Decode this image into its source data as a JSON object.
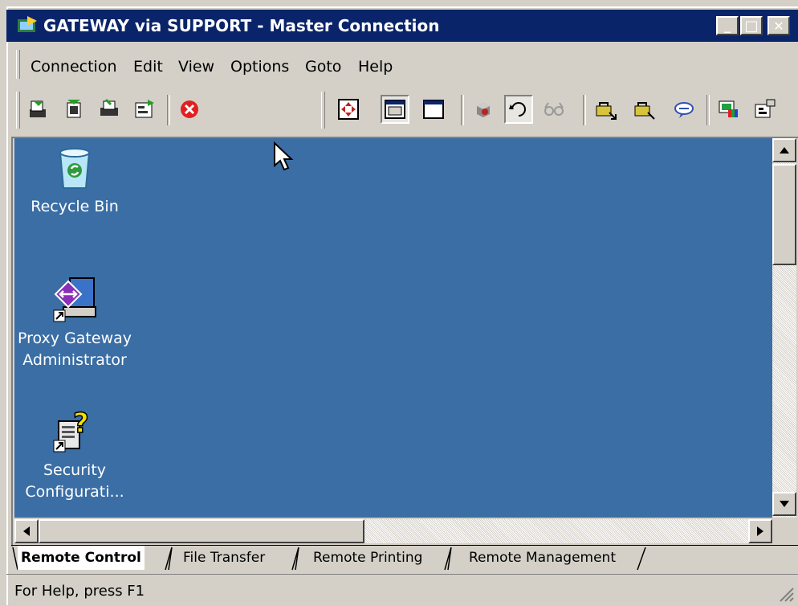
{
  "window": {
    "title": "GATEWAY via SUPPORT - Master Connection"
  },
  "title_buttons": {
    "minimize": "_",
    "maximize": "□",
    "close": "✕"
  },
  "menu": [
    {
      "label": "Connection"
    },
    {
      "label": "Edit"
    },
    {
      "label": "View"
    },
    {
      "label": "Options"
    },
    {
      "label": "Goto"
    },
    {
      "label": "Help"
    }
  ],
  "toolbar": {
    "icons": [
      "connect-icon",
      "disconnect-icon",
      "print-icon",
      "properties-icon",
      "stop-icon",
      "full-screen-icon",
      "window-icon",
      "window-frame-icon",
      "record-icon",
      "rotate-icon",
      "view-only-icon",
      "lock-keyboard-icon",
      "lock-mouse-icon",
      "chat-icon",
      "color-display-icon",
      "settings-icon"
    ]
  },
  "desktop": {
    "icons": [
      {
        "label_line1": "Recycle Bin",
        "label_line2": ""
      },
      {
        "label_line1": "Proxy Gateway",
        "label_line2": "Administrator"
      },
      {
        "label_line1": "Security",
        "label_line2": "Configurati..."
      }
    ]
  },
  "tabs": [
    {
      "label": "Remote Control",
      "active": true
    },
    {
      "label": "File Transfer",
      "active": false
    },
    {
      "label": "Remote Printing",
      "active": false
    },
    {
      "label": "Remote Management",
      "active": false
    }
  ],
  "status": {
    "text": "For Help, press F1"
  },
  "colors": {
    "titlebar": "#0a246a",
    "desktop": "#3a6ea5",
    "chrome": "#d4d0c8"
  }
}
